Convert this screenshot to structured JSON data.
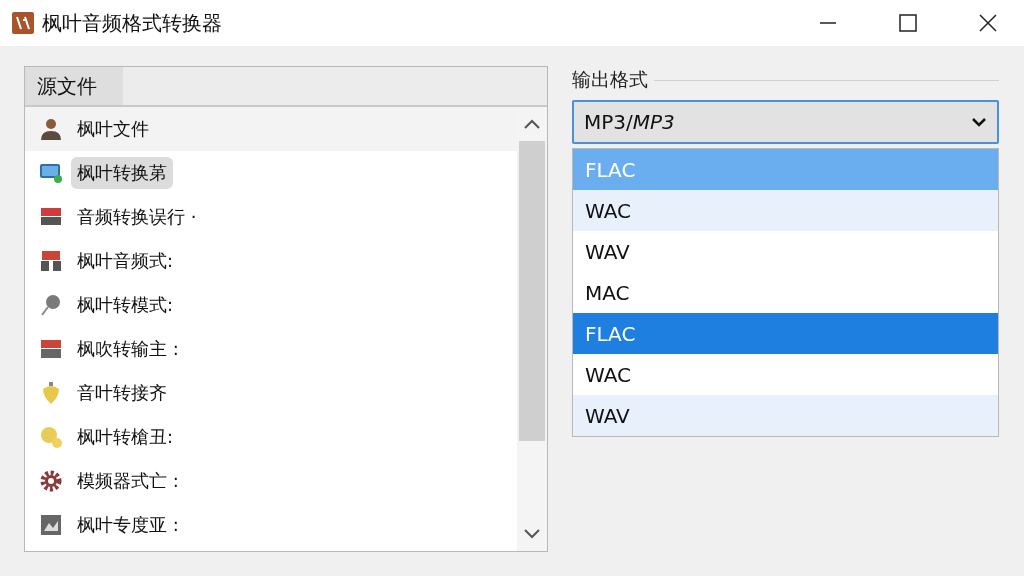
{
  "window": {
    "title": "枫叶音频格式转换器"
  },
  "source_panel": {
    "header": "源文件",
    "items": [
      {
        "label": "枫叶文件",
        "selected": false
      },
      {
        "label": "枫叶转换苐",
        "selected": true
      },
      {
        "label": "音频转换误行 ·",
        "selected": false
      },
      {
        "label": "枫叶音频式:",
        "selected": false
      },
      {
        "label": "枫叶转模式:",
        "selected": false
      },
      {
        "label": "枫吹转输主 :",
        "selected": false
      },
      {
        "label": "音叶转接齐",
        "selected": false
      },
      {
        "label": "枫叶转槍丑:",
        "selected": false
      },
      {
        "label": "模频器式亡 :",
        "selected": false
      },
      {
        "label": "枫叶专度亚 :",
        "selected": false
      }
    ]
  },
  "output_format": {
    "label": "输出格式",
    "value": "MP3/*MP3*",
    "options": [
      {
        "label": "FLAC",
        "kind": "hover"
      },
      {
        "label": "WAC",
        "kind": "alternate"
      },
      {
        "label": "WAV",
        "kind": "plain"
      },
      {
        "label": "MAC",
        "kind": "plain"
      },
      {
        "label": "FLAC",
        "kind": "selected"
      },
      {
        "label": "WAC",
        "kind": "plain"
      },
      {
        "label": "WAV",
        "kind": "alternate"
      }
    ]
  }
}
